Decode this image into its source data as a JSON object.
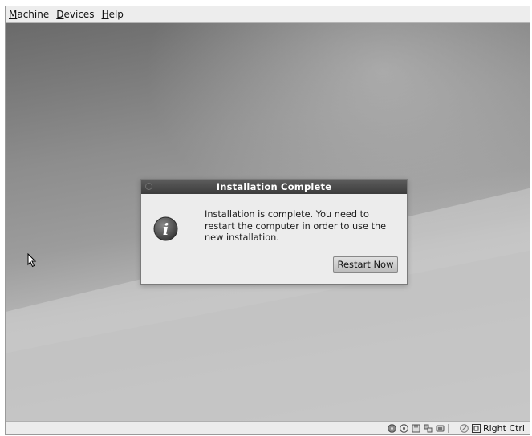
{
  "menubar": {
    "items": [
      {
        "label": "Machine",
        "accel": "M"
      },
      {
        "label": "Devices",
        "accel": "D"
      },
      {
        "label": "Help",
        "accel": "H"
      }
    ]
  },
  "dialog": {
    "title": "Installation Complete",
    "message": "Installation is complete. You need to restart the computer in order to use the new installation.",
    "button_label": "Restart Now",
    "icon": "info-icon"
  },
  "status_bar": {
    "icons": [
      "hard-disk-icon",
      "optical-drive-icon",
      "floppy-icon",
      "network-icon",
      "usb-icon",
      "shared-folders-icon",
      "mouse-integration-icon"
    ],
    "host_key_label": "Right Ctrl"
  }
}
